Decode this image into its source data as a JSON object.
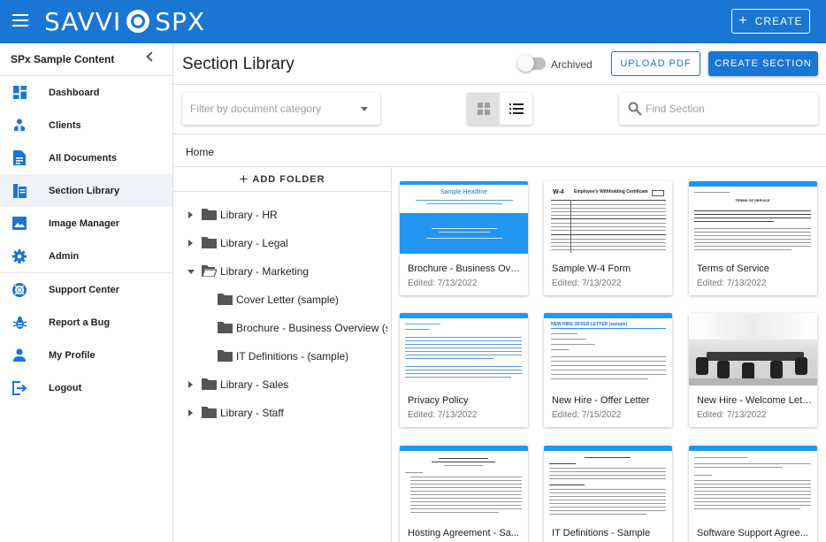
{
  "topbar": {
    "logo_left": "SAVVI",
    "logo_right": "SPX",
    "create_label": "CREATE",
    "accent": "#1976d2"
  },
  "sidebar": {
    "header": "SPx Sample Content",
    "items": [
      {
        "label": "Dashboard",
        "icon": "dashboard-icon"
      },
      {
        "label": "Clients",
        "icon": "clients-icon"
      },
      {
        "label": "All Documents",
        "icon": "document-icon"
      },
      {
        "label": "Section Library",
        "icon": "section-library-icon",
        "active": true
      },
      {
        "label": "Image Manager",
        "icon": "image-icon"
      },
      {
        "label": "Admin",
        "icon": "gear-icon"
      },
      {
        "label": "Support Center",
        "icon": "lifebuoy-icon"
      },
      {
        "label": "Report a Bug",
        "icon": "bug-icon"
      },
      {
        "label": "My Profile",
        "icon": "person-icon"
      },
      {
        "label": "Logout",
        "icon": "logout-icon"
      }
    ]
  },
  "main": {
    "title": "Section Library",
    "archived_label": "Archived",
    "upload_label": "UPLOAD PDF",
    "create_section_label": "CREATE SECTION",
    "filter_placeholder": "Filter by document category",
    "search_placeholder": "Find Section",
    "breadcrumb": "Home"
  },
  "tree": {
    "add_folder_label": "ADD FOLDER",
    "nodes": [
      {
        "label": "Library - HR",
        "expanded": false
      },
      {
        "label": "Library - Legal",
        "expanded": false
      },
      {
        "label": "Library - Marketing",
        "expanded": true
      },
      {
        "label": "Cover Letter (sample)"
      },
      {
        "label": "Brochure - Business Overview (s..."
      },
      {
        "label": "IT Definitions - (sample)"
      },
      {
        "label": "Library - Sales",
        "expanded": false
      },
      {
        "label": "Library - Staff",
        "expanded": false
      }
    ]
  },
  "cards": [
    {
      "title": "Brochure - Business Over...",
      "edited": "Edited: 7/13/2022",
      "thumb": "brochure"
    },
    {
      "title": "Sample W-4 Form",
      "edited": "Edited: 7/13/2022",
      "thumb": "w4"
    },
    {
      "title": "Terms of Service",
      "edited": "Edited: 7/13/2022",
      "thumb": "doc"
    },
    {
      "title": "Privacy Policy",
      "edited": "Edited: 7/13/2022",
      "thumb": "doc"
    },
    {
      "title": "New Hire - Offer Letter",
      "edited": "Edited: 7/15/2022",
      "thumb": "doc"
    },
    {
      "title": "New Hire - Welcome Letter",
      "edited": "Edited: 7/13/2022",
      "thumb": "photo"
    },
    {
      "title": "Hosting Agreement - Sa...",
      "edited": "",
      "thumb": "doc"
    },
    {
      "title": "IT Definitions - Sample",
      "edited": "",
      "thumb": "doc"
    },
    {
      "title": "Software Support Agree...",
      "edited": "",
      "thumb": "doc"
    }
  ],
  "thumb_text": {
    "brochure_headline": "Sample Headline",
    "w4_label": "W-4",
    "w4_title": "Employee's Withholding Certificate",
    "offer_letter": "NEW HIRE OFFER LETTER (sample)",
    "tos_heading": "TERMS OF SERVICE"
  }
}
